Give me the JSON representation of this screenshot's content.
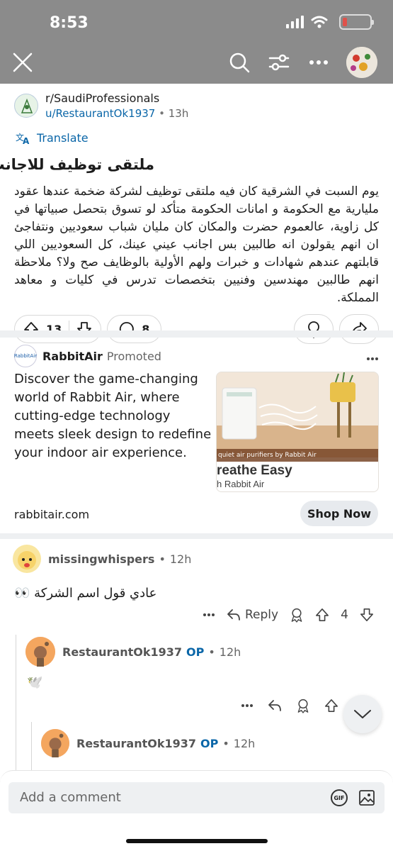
{
  "status": {
    "time": "8:53"
  },
  "post": {
    "subreddit": "r/SaudiProfessionals",
    "author": "u/RestaurantOk1937",
    "age": "13h",
    "translate_label": "Translate",
    "title": "ملتقى توظيف للاجانب",
    "body": "يوم السبت في الشرقية كان فيه ملتقى توظيف لشركة ضخمة عندها عقود مليارية مع الحكومة و امانات الحكومة متأكد لو تسوق بتحصل صبياتها في كل زاوية، عالعموم حضرت والمكان كان مليان شباب سعوديين ونتفاجئ ان انهم يقولون انه طالبين بس اجانب عيني عينك، كل السعوديين اللي قابلتهم عندهم شهادات و خبرات ولهم الأولية بالوظايف صح ولا؟ ملاحظة انهم طالبين مهندسين وفنيين بتخصصات تدرس في كليات و معاهد المملكة.",
    "upvotes": "13",
    "comments": "8"
  },
  "ad": {
    "advertiser": "RabbitAir",
    "promoted_label": "Promoted",
    "text": "Discover the game-changing world of Rabbit Air, where cutting-edge technology meets sleek design to redefine your indoor air experience.",
    "image_caption": "quiet air purifiers by Rabbit Air",
    "image_headline": "reathe Easy",
    "image_sub": "h Rabbit Air",
    "logo_text": "RabbitAir",
    "domain": "rabbitair.com",
    "cta": "Shop Now"
  },
  "comments": [
    {
      "user": "missingwhispers",
      "age": "12h",
      "body": "عادي قول اسم الشركة 👀",
      "reply_label": "Reply",
      "score": "4"
    },
    {
      "user": "RestaurantOk1937",
      "op": "OP",
      "age": "12h",
      "body": "🕊️"
    },
    {
      "user": "RestaurantOk1937",
      "op": "OP",
      "age": "12h"
    }
  ],
  "composer": {
    "placeholder": "Add a comment",
    "gif_label": "GIF"
  },
  "colors": {
    "link": "#0a66a8",
    "overlay": "#8b8b8b"
  }
}
